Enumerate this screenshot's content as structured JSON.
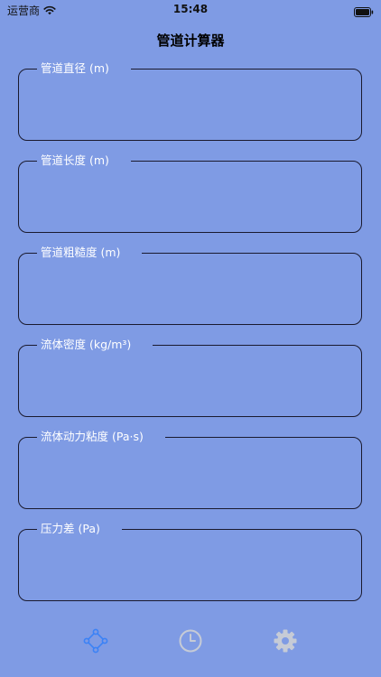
{
  "status_bar": {
    "carrier": "运营商",
    "time": "15:48"
  },
  "nav": {
    "title": "管道计算器"
  },
  "fields": [
    {
      "label": "管道直径 (m)",
      "value": ""
    },
    {
      "label": "管道长度 (m)",
      "value": ""
    },
    {
      "label": "管道粗糙度 (m)",
      "value": ""
    },
    {
      "label": "流体密度 (kg/m³)",
      "value": ""
    },
    {
      "label": "流体动力粘度 (Pa·s)",
      "value": ""
    },
    {
      "label": "压力差 (Pa)",
      "value": ""
    }
  ],
  "tab_bar": {
    "tabs": [
      {
        "icon": "calculator-nodes-icon",
        "selected": true,
        "color": "#3b82f6"
      },
      {
        "icon": "clock-icon",
        "selected": false,
        "color": "#c6cbd6"
      },
      {
        "icon": "gear-icon",
        "selected": false,
        "color": "#c6cbd6"
      }
    ]
  }
}
